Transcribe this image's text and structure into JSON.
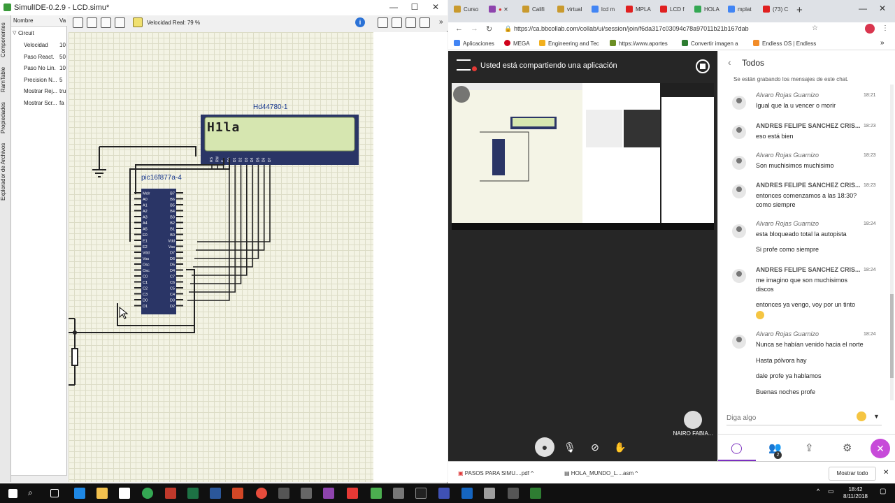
{
  "simulide": {
    "title": "SimulIDE-0.2.9  -  LCD.simu*",
    "window_controls": {
      "minimize": "—",
      "maximize": "☐",
      "close": "✕"
    },
    "side_tabs": [
      "Componentes",
      "RamTable",
      "Propiedades",
      "Explorador de Archivos"
    ],
    "properties": {
      "header_name": "Nombre",
      "header_value": "Va",
      "group": "Circuit",
      "rows": [
        {
          "name": "Velocidad",
          "value": "10"
        },
        {
          "name": "Paso React.",
          "value": "50"
        },
        {
          "name": "Paso No Lin.",
          "value": "10"
        },
        {
          "name": "Precision N...",
          "value": "5"
        },
        {
          "name": "Mostrar Rej...",
          "value": "tru"
        },
        {
          "name": "Mostrar Scr...",
          "value": "fa"
        }
      ]
    },
    "speed_label": "Velocidad Real: 79 %",
    "info_icon": "i",
    "lcd": {
      "label": "Hd44780-1",
      "text": "H1la",
      "pins": [
        "RS",
        "RW",
        "E",
        "D0",
        "D1",
        "D2",
        "D3",
        "D4",
        "D5",
        "D6",
        "D7"
      ]
    },
    "pic": {
      "label": "pic16f877a-4",
      "left_pins": [
        "Mclr",
        "A0",
        "A1",
        "A2",
        "A3",
        "A4",
        "A5",
        "E0",
        "E1",
        "E2",
        "Vdd",
        "Vss",
        "Osc",
        "Osc",
        "C0",
        "C1",
        "C2",
        "C3",
        "D0",
        "D1"
      ],
      "right_pins": [
        "B7",
        "B6",
        "B5",
        "B4",
        "B3",
        "B2",
        "B1",
        "B0",
        "Vdd",
        "Vss",
        "D7",
        "D6",
        "D5",
        "D4",
        "C7",
        "C6",
        "C5",
        "C4",
        "D3",
        "D2"
      ]
    }
  },
  "chrome": {
    "tabs": [
      {
        "label": "Curso",
        "color": "#c99a2e"
      },
      {
        "label": "",
        "color": "#8e44ad"
      },
      {
        "label": "Califi",
        "color": "#c99a2e"
      },
      {
        "label": "virtual",
        "color": "#c99a2e"
      },
      {
        "label": "lcd m",
        "color": "#4285f4"
      },
      {
        "label": "MPLA",
        "color": "#e02020"
      },
      {
        "label": "LCD f",
        "color": "#e02020"
      },
      {
        "label": "HOLA",
        "color": "#34a853"
      },
      {
        "label": "mplat",
        "color": "#4285f4"
      },
      {
        "label": "(73) C",
        "color": "#e02020"
      }
    ],
    "url": "https://ca.bbcollab.com/collab/ui/session/join/f6da317c03094c78a97011b21b167dab",
    "bookmarks": [
      {
        "label": "Aplicaciones",
        "color": "#4285f4"
      },
      {
        "label": "MEGA",
        "color": "#d0021b"
      },
      {
        "label": "Engineering and Tec",
        "color": "#f2b01e"
      },
      {
        "label": "https://www.aportes",
        "color": "#6b8e23"
      },
      {
        "label": "Convertir imagen a",
        "color": "#2e7d32"
      },
      {
        "label": "Endless OS | Endless",
        "color": "#f28c28"
      }
    ],
    "collab": {
      "sharing_text": "Usted está compartiendo una aplicación",
      "participant_name": "NAIRO FABIA..."
    },
    "chat": {
      "title": "Todos",
      "recording_note": "Se están grabando los mensajes de este chat.",
      "messages": [
        {
          "name": "Alvaro Rojas Guarnizo",
          "time": "18:21",
          "lines": [
            "Igual que la u vencer o morir"
          ]
        },
        {
          "name": "ANDRES FELIPE SANCHEZ CRIS...",
          "time": "18:23",
          "lines": [
            "eso está bien"
          ]
        },
        {
          "name": "Alvaro Rojas Guarnizo",
          "time": "18:23",
          "lines": [
            "Son muchisimos muchisimo"
          ]
        },
        {
          "name": "ANDRES FELIPE SANCHEZ CRIS...",
          "time": "18:23",
          "lines": [
            "entonces comenzamos a las 18:30?",
            "como siempre"
          ]
        },
        {
          "name": "Alvaro Rojas Guarnizo",
          "time": "18:24",
          "lines": [
            "esta bloqueado total la autopista",
            "Si profe como siempre"
          ]
        },
        {
          "name": "ANDRES FELIPE SANCHEZ CRIS...",
          "time": "18:24",
          "lines": [
            "me imagino que son muchisimos",
            "discos",
            "entonces ya vengo, voy por un tinto"
          ]
        },
        {
          "name": "Alvaro Rojas Guarnizo",
          "time": "18:24",
          "lines": [
            "Nunca se habían venido hacia el norte",
            "Hasta pólvora hay",
            "dale profe ya hablamos",
            "Buenas noches profe"
          ]
        }
      ],
      "input_placeholder": "Diga algo",
      "participants_badge": "2"
    },
    "downloads": [
      {
        "label": "PASOS PARA SIMU....pdf"
      },
      {
        "label": "HOLA_MUNDO_L....asm"
      }
    ],
    "show_all": "Mostrar todo"
  },
  "taskbar": {
    "time": "18:42",
    "date": "8/11/2018"
  }
}
